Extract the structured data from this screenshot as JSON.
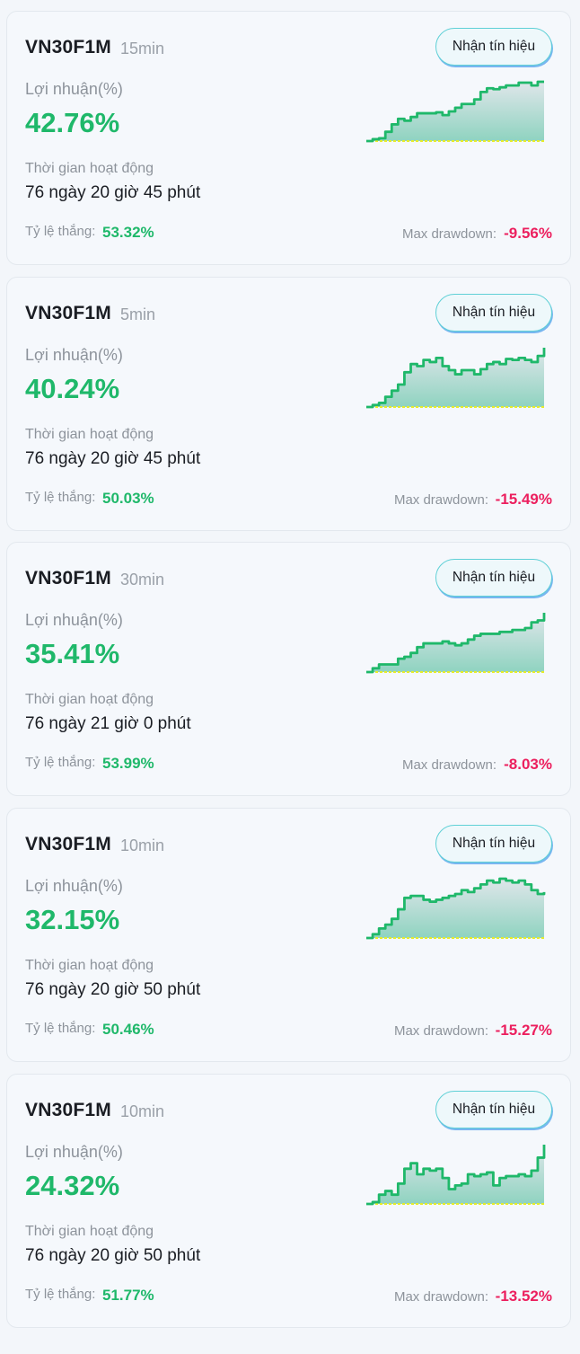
{
  "strategies": [
    {
      "symbol": "VN30F1M",
      "interval": "15min",
      "signal_button": "Nhận tín hiệu",
      "profit_label": "Lợi nhuận(%)",
      "profit": "42.76%",
      "active_label": "Thời gian hoạt động",
      "active_time": "76 ngày 20 giờ 45 phút",
      "win_rate_label": "Tỷ lệ thắng:",
      "win_rate": "53.32%",
      "drawdown_label": "Max drawdown:",
      "drawdown": "-9.56%",
      "equity_curve": [
        0,
        2,
        3,
        10,
        18,
        24,
        22,
        26,
        30,
        30,
        30,
        31,
        28,
        32,
        36,
        40,
        40,
        45,
        53,
        57,
        56,
        58,
        60,
        60,
        63,
        63,
        60,
        64,
        64
      ]
    },
    {
      "symbol": "VN30F1M",
      "interval": "5min",
      "signal_button": "Nhận tín hiệu",
      "profit_label": "Lợi nhuận(%)",
      "profit": "40.24%",
      "active_label": "Thời gian hoạt động",
      "active_time": "76 ngày 20 giờ 45 phút",
      "win_rate_label": "Tỷ lệ thắng:",
      "win_rate": "50.03%",
      "drawdown_label": "Max drawdown:",
      "drawdown": "-15.49%",
      "equity_curve": [
        0,
        2,
        4,
        10,
        16,
        22,
        34,
        42,
        40,
        46,
        44,
        48,
        40,
        36,
        32,
        36,
        36,
        32,
        37,
        42,
        44,
        42,
        47,
        46,
        48,
        46,
        44,
        50,
        58
      ]
    },
    {
      "symbol": "VN30F1M",
      "interval": "30min",
      "signal_button": "Nhận tín hiệu",
      "profit_label": "Lợi nhuận(%)",
      "profit": "35.41%",
      "active_label": "Thời gian hoạt động",
      "active_time": "76 ngày 21 giờ 0 phút",
      "win_rate_label": "Tỷ lệ thắng:",
      "win_rate": "53.99%",
      "drawdown_label": "Max drawdown:",
      "drawdown": "-8.03%",
      "equity_curve": [
        0,
        4,
        8,
        8,
        8,
        14,
        16,
        20,
        26,
        30,
        30,
        30,
        32,
        30,
        28,
        30,
        34,
        38,
        40,
        40,
        40,
        42,
        42,
        44,
        44,
        46,
        52,
        54,
        62
      ]
    },
    {
      "symbol": "VN30F1M",
      "interval": "10min",
      "signal_button": "Nhận tín hiệu",
      "profit_label": "Lợi nhuận(%)",
      "profit": "32.15%",
      "active_label": "Thời gian hoạt động",
      "active_time": "76 ngày 20 giờ 50 phút",
      "win_rate_label": "Tỷ lệ thắng:",
      "win_rate": "50.46%",
      "drawdown_label": "Max drawdown:",
      "drawdown": "-15.27%",
      "equity_curve": [
        0,
        4,
        10,
        14,
        20,
        30,
        42,
        44,
        44,
        40,
        38,
        40,
        42,
        44,
        46,
        50,
        48,
        52,
        56,
        60,
        58,
        62,
        60,
        58,
        60,
        56,
        50,
        46,
        48
      ]
    },
    {
      "symbol": "VN30F1M",
      "interval": "10min",
      "signal_button": "Nhận tín hiệu",
      "profit_label": "Lợi nhuận(%)",
      "profit": "24.32%",
      "active_label": "Thời gian hoạt động",
      "active_time": "76 ngày 20 giờ 50 phút",
      "win_rate_label": "Tỷ lệ thắng:",
      "win_rate": "51.77%",
      "drawdown_label": "Max drawdown:",
      "drawdown": "-13.52%",
      "equity_curve": [
        0,
        2,
        10,
        14,
        10,
        22,
        38,
        44,
        32,
        38,
        36,
        38,
        28,
        16,
        20,
        22,
        32,
        30,
        32,
        34,
        20,
        28,
        30,
        30,
        32,
        30,
        36,
        50,
        64
      ]
    }
  ],
  "colors": {
    "profit_green": "#1fb86a",
    "drawdown_red": "#ec1f5e",
    "curve_line": "#1fb86a",
    "baseline": "#e6ec2a"
  }
}
